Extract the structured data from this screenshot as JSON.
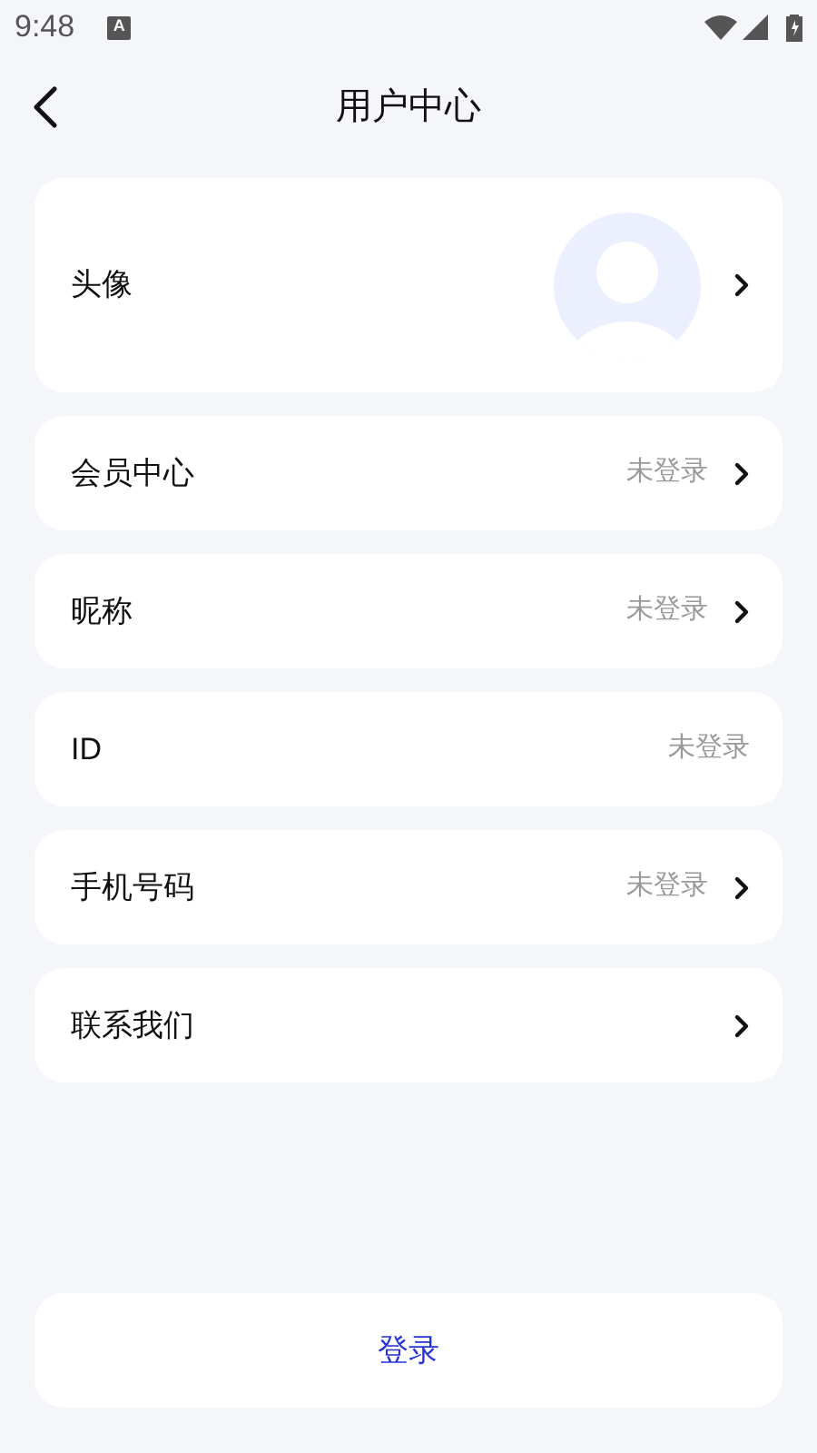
{
  "status_bar": {
    "time": "9:48",
    "notification_icon": "A"
  },
  "header": {
    "title": "用户中心"
  },
  "avatar_row": {
    "label": "头像",
    "chevron": true
  },
  "rows": [
    {
      "label": "会员中心",
      "value": "未登录",
      "chevron": true
    },
    {
      "label": "昵称",
      "value": "未登录",
      "chevron": true
    },
    {
      "label": "ID",
      "value": "未登录",
      "chevron": false
    },
    {
      "label": "手机号码",
      "value": "未登录",
      "chevron": true
    },
    {
      "label": "联系我们",
      "chevron": true
    }
  ],
  "login_button": {
    "label": "登录"
  }
}
